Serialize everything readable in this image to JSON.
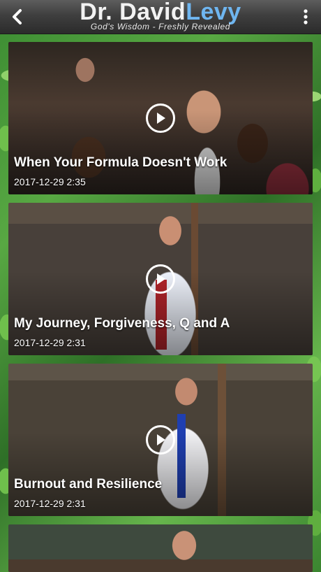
{
  "header": {
    "logo_first": "Dr. David",
    "logo_second": "Levy",
    "tagline": "God's Wisdom - Freshly Revealed",
    "back_icon": "chevron-left-icon",
    "menu_icon": "more-vertical-icon"
  },
  "videos": [
    {
      "title": "When Your Formula Doesn't Work",
      "date": "2017-12-29 2:35"
    },
    {
      "title": "My Journey, Forgiveness, Q and A",
      "date": "2017-12-29 2:31"
    },
    {
      "title": "Burnout and Resilience",
      "date": "2017-12-29 2:31"
    },
    {
      "title": "",
      "date": ""
    }
  ],
  "colors": {
    "logo_accent": "#6fb6f0",
    "header_bg": "#3f3f3f"
  }
}
